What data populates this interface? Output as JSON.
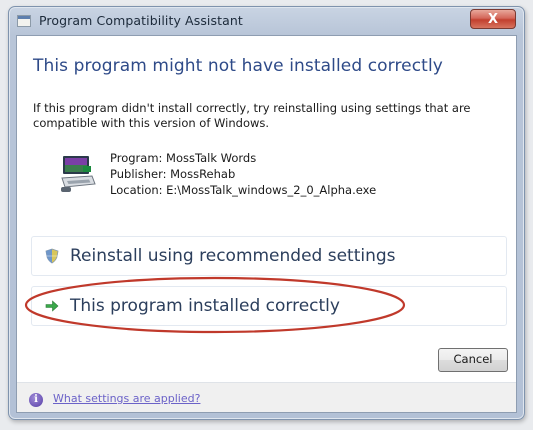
{
  "window": {
    "title": "Program Compatibility Assistant",
    "close_label": "X"
  },
  "content": {
    "heading": "This program might not have installed correctly",
    "description": "If this program didn't install correctly, try reinstalling using settings that are compatible with this version of Windows.",
    "program": {
      "name_line": "Program: MossTalk Words",
      "publisher_line": "Publisher: MossRehab",
      "location_line": "Location: E:\\MossTalk_windows_2_0_Alpha.exe"
    },
    "options": [
      {
        "label": "Reinstall using recommended settings",
        "icon": "shield-icon"
      },
      {
        "label": "This program installed correctly",
        "icon": "green-arrow-icon"
      }
    ]
  },
  "buttons": {
    "cancel_label": "Cancel"
  },
  "footer": {
    "link_label": "What settings are applied?",
    "icon": "info-icon"
  },
  "colors": {
    "heading": "#2e4a88",
    "highlight_ellipse": "#c0392b",
    "option_arrow": "#3aa84a",
    "link": "#6b62c8"
  }
}
